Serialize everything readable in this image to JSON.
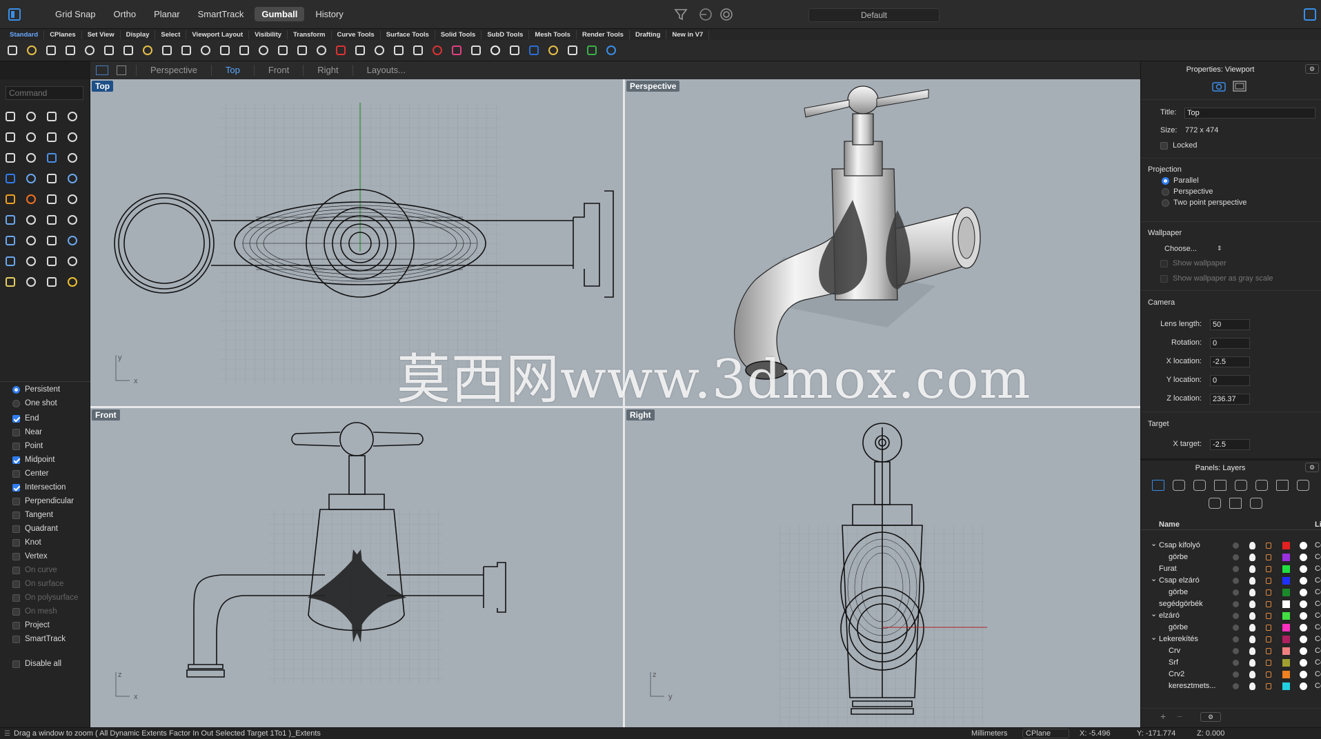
{
  "topbar": {
    "modes": [
      "Grid Snap",
      "Ortho",
      "Planar",
      "SmartTrack",
      "Gumball",
      "History"
    ],
    "active_mode": "Gumball",
    "display_mode": "Default"
  },
  "ribbon_tabs": [
    "Standard",
    "CPlanes",
    "Set View",
    "Display",
    "Select",
    "Viewport Layout",
    "Visibility",
    "Transform",
    "Curve Tools",
    "Surface Tools",
    "Solid Tools",
    "SubD Tools",
    "Mesh Tools",
    "Render Tools",
    "Drafting",
    "New in V7"
  ],
  "active_ribbon_tab": "Standard",
  "viewport_tabs": [
    "Perspective",
    "Top",
    "Front",
    "Right",
    "Layouts..."
  ],
  "active_viewport_tab": "Top",
  "command": {
    "placeholder": "Command"
  },
  "osnaps": [
    {
      "label": "Persistent",
      "type": "radio",
      "checked": true,
      "enabled": true
    },
    {
      "label": "One shot",
      "type": "radio",
      "checked": false,
      "enabled": true
    },
    {
      "label": "End",
      "type": "check",
      "checked": true,
      "enabled": true
    },
    {
      "label": "Near",
      "type": "check",
      "checked": false,
      "enabled": true
    },
    {
      "label": "Point",
      "type": "check",
      "checked": false,
      "enabled": true
    },
    {
      "label": "Midpoint",
      "type": "check",
      "checked": true,
      "enabled": true
    },
    {
      "label": "Center",
      "type": "check",
      "checked": false,
      "enabled": true
    },
    {
      "label": "Intersection",
      "type": "check",
      "checked": true,
      "enabled": true
    },
    {
      "label": "Perpendicular",
      "type": "check",
      "checked": false,
      "enabled": true
    },
    {
      "label": "Tangent",
      "type": "check",
      "checked": false,
      "enabled": true
    },
    {
      "label": "Quadrant",
      "type": "check",
      "checked": false,
      "enabled": true
    },
    {
      "label": "Knot",
      "type": "check",
      "checked": false,
      "enabled": true
    },
    {
      "label": "Vertex",
      "type": "check",
      "checked": false,
      "enabled": true
    },
    {
      "label": "On curve",
      "type": "check",
      "checked": false,
      "enabled": false
    },
    {
      "label": "On surface",
      "type": "check",
      "checked": false,
      "enabled": false
    },
    {
      "label": "On polysurface",
      "type": "check",
      "checked": false,
      "enabled": false
    },
    {
      "label": "On mesh",
      "type": "check",
      "checked": false,
      "enabled": false
    },
    {
      "label": "Project",
      "type": "check",
      "checked": false,
      "enabled": true
    },
    {
      "label": "SmartTrack",
      "type": "check",
      "checked": false,
      "enabled": true
    },
    {
      "label": "Disable all",
      "type": "check",
      "checked": false,
      "enabled": true
    }
  ],
  "viewports": {
    "top": {
      "label": "Top"
    },
    "perspective": {
      "label": "Perspective"
    },
    "front": {
      "label": "Front"
    },
    "right": {
      "label": "Right"
    }
  },
  "axes": {
    "x": "x",
    "y": "y",
    "z": "z"
  },
  "watermark": "莫西网www.3dmox.com",
  "properties": {
    "header": "Properties: Viewport",
    "title_label": "Title:",
    "title_value": "Top",
    "size_label": "Size:",
    "size_value": "772 x 474",
    "locked_label": "Locked",
    "projection_header": "Projection",
    "projection_options": [
      "Parallel",
      "Perspective",
      "Two point perspective"
    ],
    "projection_selected": "Parallel",
    "wallpaper_header": "Wallpaper",
    "wallpaper_choose": "Choose...",
    "show_wallpaper": "Show wallpaper",
    "show_gray": "Show wallpaper as gray scale",
    "camera_header": "Camera",
    "lens_label": "Lens length:",
    "lens_value": "50",
    "rotation_label": "Rotation:",
    "rotation_value": "0",
    "xloc_label": "X location:",
    "xloc_value": "-2.5",
    "yloc_label": "Y location:",
    "yloc_value": "0",
    "zloc_label": "Z location:",
    "zloc_value": "236.37",
    "target_header": "Target",
    "xtarget_label": "X target:",
    "xtarget_value": "-2.5"
  },
  "layers": {
    "header": "Panels: Layers",
    "col_name": "Name",
    "col_li": "Li",
    "rows": [
      {
        "name": "Csap kifolyó",
        "indent": 0,
        "expanded": true,
        "color": "#e52020",
        "ln": "Co"
      },
      {
        "name": "görbe",
        "indent": 1,
        "expanded": null,
        "color": "#9b30e0",
        "ln": "Co"
      },
      {
        "name": "Furat",
        "indent": 0,
        "expanded": null,
        "color": "#20e040",
        "ln": "Co"
      },
      {
        "name": "Csap elzáró",
        "indent": 0,
        "expanded": true,
        "color": "#2030ff",
        "ln": "Co"
      },
      {
        "name": "görbe",
        "indent": 1,
        "expanded": null,
        "color": "#1a8a2a",
        "ln": "Co"
      },
      {
        "name": "segédgörbék",
        "indent": 0,
        "expanded": null,
        "color": "#ffffff",
        "ln": "Co"
      },
      {
        "name": "elzáró",
        "indent": 0,
        "expanded": true,
        "color": "#40e040",
        "ln": "Co"
      },
      {
        "name": "görbe",
        "indent": 1,
        "expanded": null,
        "color": "#ff30c0",
        "ln": "Co"
      },
      {
        "name": "Lekerekítés",
        "indent": 0,
        "expanded": true,
        "color": "#b02060",
        "ln": "Co"
      },
      {
        "name": "Crv",
        "indent": 1,
        "expanded": null,
        "color": "#f08080",
        "ln": "Co"
      },
      {
        "name": "Srf",
        "indent": 1,
        "expanded": null,
        "color": "#a0a030",
        "ln": "Co"
      },
      {
        "name": "Crv2",
        "indent": 1,
        "expanded": null,
        "color": "#f08020",
        "ln": "Co"
      },
      {
        "name": "keresztmets...",
        "indent": 1,
        "expanded": null,
        "color": "#20d0e0",
        "ln": "Co"
      }
    ]
  },
  "status": {
    "message": "Drag a window to zoom ( All Dynamic Extents Factor In Out Selected Target 1To1 )_Extents",
    "units": "Millimeters",
    "cplane": "CPlane",
    "x": "X: -5.496",
    "y": "Y: -171.774",
    "z": "Z: 0.000"
  },
  "colors": {
    "accent": "#2f7df1",
    "viewport_bg": "#a6aeb6",
    "active_label": "#1e4f86"
  }
}
